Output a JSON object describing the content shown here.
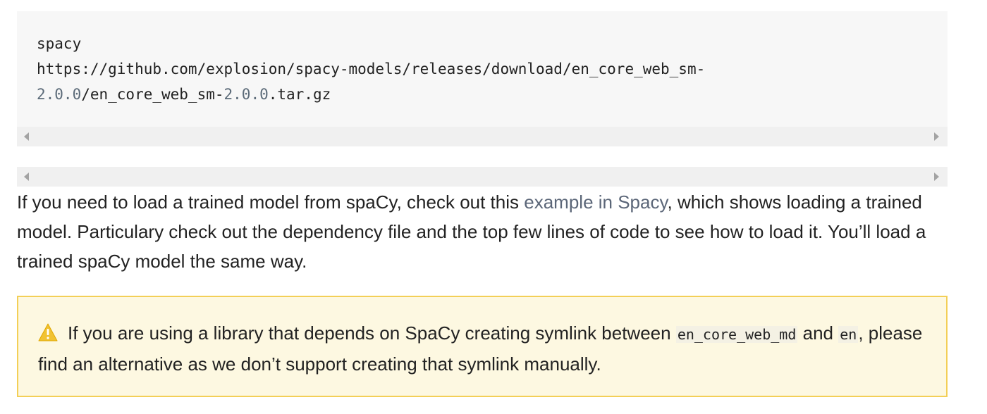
{
  "code_block": {
    "line1": "spacy",
    "line2": "https://github.com/explosion/spacy-models/releases/download/en_core_web_sm-",
    "line3_num1": "2.0.0",
    "line3_mid": "/en_core_web_sm-",
    "line3_num2": "2.0.0",
    "line3_end": ".tar.gz"
  },
  "paragraph": {
    "text_before_link": "If you need to load a trained model from spaCy, check out this ",
    "link_text": "example in Spacy",
    "text_after_link": ", which shows loading a trained model. Particulary check out the dependency file and the top few lines of code to see how to load it. You’ll load a trained spaCy model the same way."
  },
  "warning": {
    "icon": "warning-triangle-icon",
    "text_1": "If you are using a library that depends on SpaCy creating symlink between ",
    "code_1": "en_core_web_md",
    "text_2": " and ",
    "code_2": "en",
    "text_3": ", please find an alternative as we don’t support creating that symlink manually.",
    "border_color": "#f3cf57",
    "background_color": "#fdf8e1"
  },
  "colors": {
    "link": "#5b6678",
    "code_number": "#5c6b79",
    "warning_icon": "#f1c232"
  }
}
